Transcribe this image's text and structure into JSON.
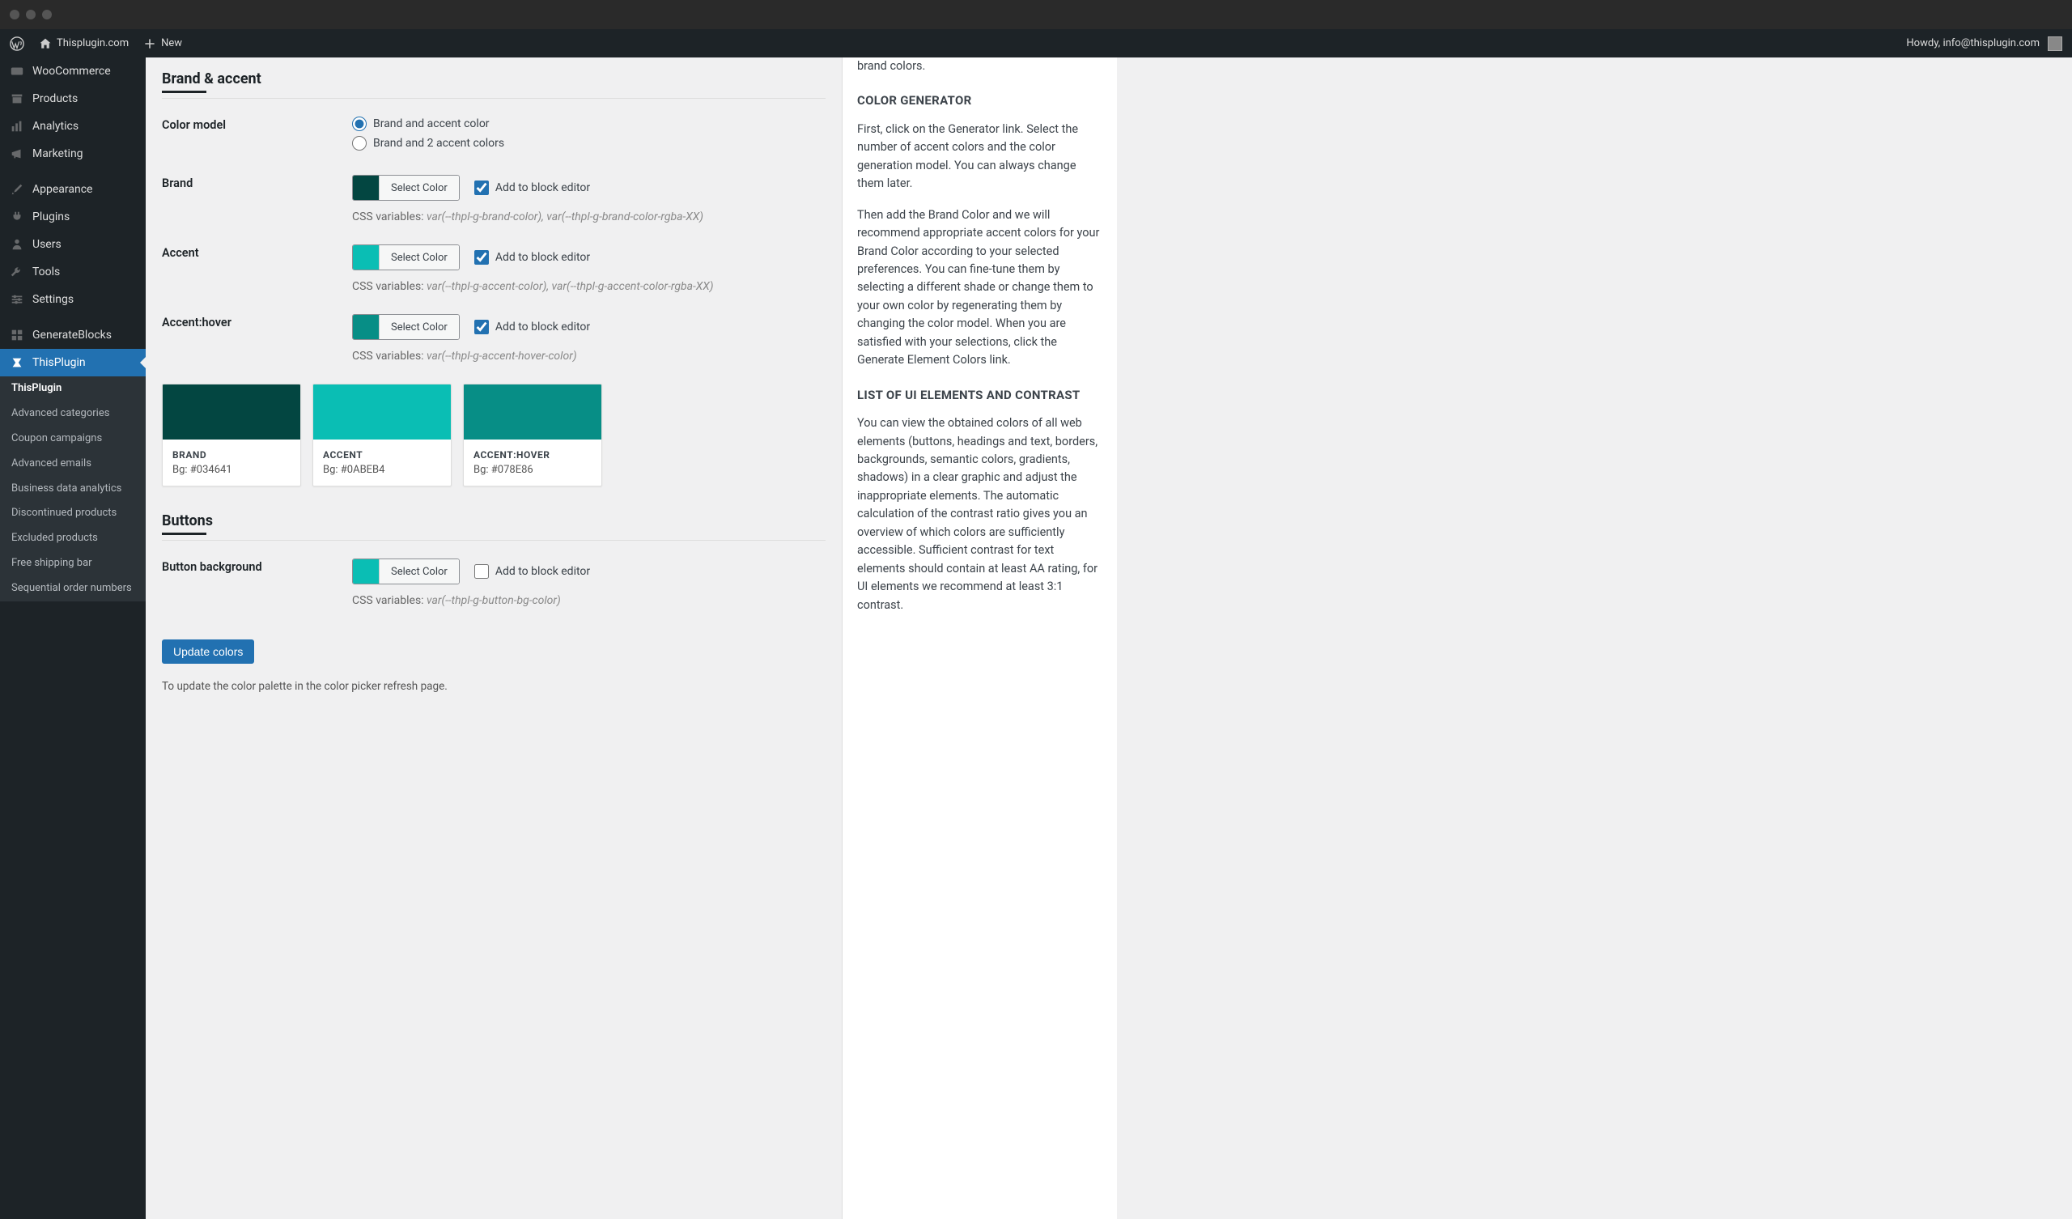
{
  "adminbar": {
    "site_name": "Thisplugin.com",
    "new_label": "New",
    "howdy": "Howdy, info@thisplugin.com"
  },
  "sidebar": {
    "items": [
      {
        "label": "WooCommerce",
        "icon": "woocommerce"
      },
      {
        "label": "Products",
        "icon": "archive"
      },
      {
        "label": "Analytics",
        "icon": "chart"
      },
      {
        "label": "Marketing",
        "icon": "megaphone"
      },
      {
        "label": "Appearance",
        "icon": "brush",
        "sep": true
      },
      {
        "label": "Plugins",
        "icon": "plug"
      },
      {
        "label": "Users",
        "icon": "person"
      },
      {
        "label": "Tools",
        "icon": "wrench"
      },
      {
        "label": "Settings",
        "icon": "sliders"
      },
      {
        "label": "GenerateBlocks",
        "icon": "blocks",
        "sep": true
      },
      {
        "label": "ThisPlugin",
        "icon": "thisplugin",
        "active": true
      }
    ],
    "submenu": [
      {
        "label": "ThisPlugin",
        "active": true
      },
      {
        "label": "Advanced categories"
      },
      {
        "label": "Coupon campaigns"
      },
      {
        "label": "Advanced emails"
      },
      {
        "label": "Business data analytics"
      },
      {
        "label": "Discontinued products"
      },
      {
        "label": "Excluded products"
      },
      {
        "label": "Free shipping bar"
      },
      {
        "label": "Sequential order numbers"
      }
    ]
  },
  "sections": {
    "brand_accent": {
      "title": "Brand & accent",
      "color_model_label": "Color model",
      "radio_options": [
        "Brand and accent color",
        "Brand and 2 accent colors"
      ],
      "radio_selected": 0,
      "rows": [
        {
          "label": "Brand",
          "swatch": "#034641",
          "btn": "Select Color",
          "add_checked": true,
          "add_label": "Add to block editor",
          "css_prefix": "CSS variables: ",
          "css_vars": "var(--thpl-g-brand-color), var(--thpl-g-brand-color-rgba-XX)"
        },
        {
          "label": "Accent",
          "swatch": "#0ABEB4",
          "btn": "Select Color",
          "add_checked": true,
          "add_label": "Add to block editor",
          "css_prefix": "CSS variables: ",
          "css_vars": "var(--thpl-g-accent-color), var(--thpl-g-accent-color-rgba-XX)"
        },
        {
          "label": "Accent:hover",
          "swatch": "#078E86",
          "btn": "Select Color",
          "add_checked": true,
          "add_label": "Add to block editor",
          "css_prefix": "CSS variables: ",
          "css_vars": "var(--thpl-g-accent-hover-color)"
        }
      ],
      "swatches": [
        {
          "name": "BRAND",
          "bg_label": "Bg: #034641",
          "color": "#034641"
        },
        {
          "name": "ACCENT",
          "bg_label": "Bg: #0ABEB4",
          "color": "#0ABEB4"
        },
        {
          "name": "ACCENT:HOVER",
          "bg_label": "Bg: #078E86",
          "color": "#078E86"
        }
      ]
    },
    "buttons": {
      "title": "Buttons",
      "rows": [
        {
          "label": "Button background",
          "swatch": "#0ABEB4",
          "btn": "Select Color",
          "add_checked": false,
          "add_label": "Add to block editor",
          "css_prefix": "CSS variables: ",
          "css_vars": "var(--thpl-g-button-bg-color)"
        }
      ]
    }
  },
  "footer": {
    "update_btn": "Update colors",
    "note": "To update the color palette in the color picker refresh page."
  },
  "help": {
    "intro_tail": "brand colors.",
    "h1": "COLOR GENERATOR",
    "p1": "First, click on the Generator link. Select the number of accent colors and the color generation model. You can always change them later.",
    "p2": "Then add the Brand Color and we will recommend appropriate accent colors for your Brand Color according to your selected preferences. You can fine-tune them by selecting a different shade or change them to your own color by regenerating them by changing the color model. When you are satisfied with your selections, click the Generate Element Colors link.",
    "h2": "LIST OF UI ELEMENTS AND CONTRAST",
    "p3": "You can view the obtained colors of all web elements (buttons, headings and text, borders, backgrounds, semantic colors, gradients, shadows) in a clear graphic and adjust the inappropriate elements. The automatic calculation of the contrast ratio gives you an overview of which colors are sufficiently accessible. Sufficient contrast for text elements should contain at least AA rating, for UI elements we recommend at least 3:1 contrast."
  }
}
